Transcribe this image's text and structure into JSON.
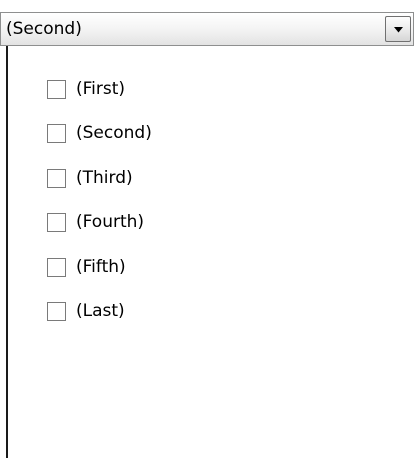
{
  "combo": {
    "selected_value": "(Second)",
    "button_icon": "chevron-down-icon"
  },
  "dropdown": {
    "options": [
      {
        "label": "(First)",
        "checked": false
      },
      {
        "label": "(Second)",
        "checked": false
      },
      {
        "label": "(Third)",
        "checked": false
      },
      {
        "label": "(Fourth)",
        "checked": false
      },
      {
        "label": "(Fifth)",
        "checked": false
      },
      {
        "label": "(Last)",
        "checked": false
      }
    ]
  }
}
